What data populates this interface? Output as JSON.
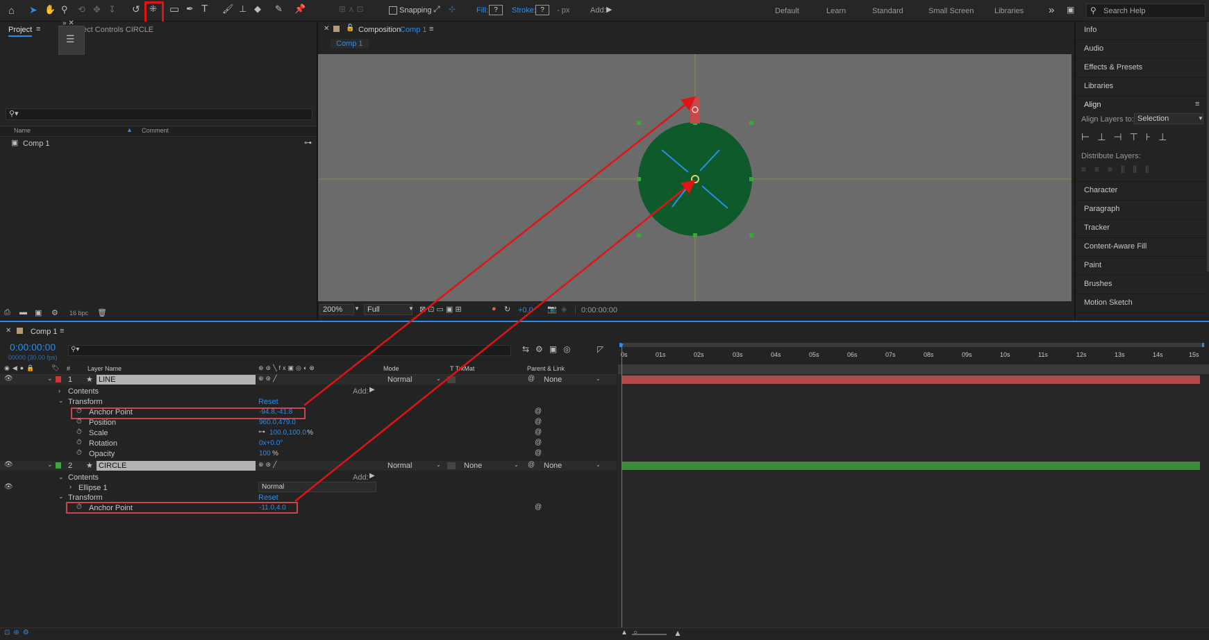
{
  "toolbar": {
    "snapping_label": "Snapping",
    "fill_label": "Fill:",
    "fill_value": "?",
    "stroke_label": "Stroke:",
    "stroke_value": "?",
    "stroke_unit": "- px",
    "add_label": "Add:",
    "workspaces": [
      "Default",
      "Learn",
      "Standard",
      "Small Screen",
      "Libraries"
    ],
    "more_label": "»",
    "search_placeholder": "Search Help"
  },
  "project_panel": {
    "tab_project": "Project",
    "tab_effect_controls": "fect Controls CIRCLE",
    "col_name": "Name",
    "col_comment": "Comment",
    "items": [
      "Comp 1"
    ],
    "bpc": "16 bpc"
  },
  "composition": {
    "tab_prefix": "Composition",
    "tab_comp": "Comp 1",
    "breadcrumb": "Comp 1",
    "zoom": "200%",
    "resolution": "Full",
    "exposure": "+0.0",
    "timecode": "0:00:00:00"
  },
  "right_panel": {
    "items_top": [
      "Info",
      "Audio",
      "Effects & Presets",
      "Libraries"
    ],
    "align_title": "Align",
    "align_layers_label": "Align Layers to:",
    "align_layers_value": "Selection",
    "distribute_label": "Distribute Layers:",
    "items_bottom": [
      "Character",
      "Paragraph",
      "Tracker",
      "Content-Aware Fill",
      "Paint",
      "Brushes",
      "Motion Sketch"
    ]
  },
  "timeline": {
    "tab_label": "Comp 1",
    "timecode": "0:00:00:00",
    "fps": "00000 (30.00 fps)",
    "headers": {
      "hash": "#",
      "layer_name": "Layer Name",
      "mode": "Mode",
      "trkmat": "T TrkMat",
      "parent": "Parent & Link"
    },
    "ruler": [
      "0s",
      "01s",
      "02s",
      "03s",
      "04s",
      "05s",
      "06s",
      "07s",
      "08s",
      "09s",
      "10s",
      "11s",
      "12s",
      "13s",
      "14s",
      "15s"
    ],
    "layers": [
      {
        "num": "1",
        "name": "LINE",
        "mode": "Normal",
        "trkmat": "",
        "parent": "None",
        "color": "#c83a3a"
      },
      {
        "num": "2",
        "name": "CIRCLE",
        "mode": "Normal",
        "trkmat": "None",
        "parent": "None",
        "color": "#3aa83a"
      }
    ],
    "line_props": {
      "contents": "Contents",
      "add": "Add:",
      "transform": "Transform",
      "reset": "Reset",
      "anchor_label": "Anchor Point",
      "anchor_value": "-94.8,-41.8",
      "position_label": "Position",
      "position_value": "960.0,479.0",
      "scale_label": "Scale",
      "scale_value": "100.0,100.0",
      "scale_unit": "%",
      "rotation_label": "Rotation",
      "rotation_value": "0x+0.0°",
      "opacity_label": "Opacity",
      "opacity_value": "100",
      "opacity_unit": "%"
    },
    "circle_props": {
      "contents": "Contents",
      "add": "Add:",
      "ellipse": "Ellipse 1",
      "ellipse_mode": "Normal",
      "transform": "Transform",
      "reset": "Reset",
      "anchor_label": "Anchor Point",
      "anchor_value": "-11.0,4.0"
    }
  },
  "colors": {
    "accent_blue": "#2d8ceb",
    "annotation_red": "#e01414",
    "circle_fill": "#0e5a2a",
    "line_layer_bar": "#b24a4a",
    "circle_layer_bar": "#3d8a3d"
  }
}
